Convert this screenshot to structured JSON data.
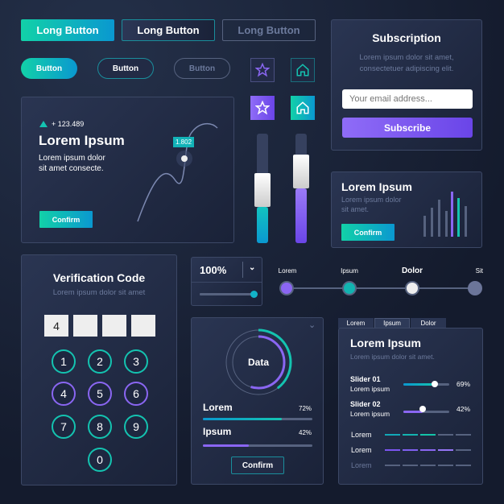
{
  "buttons": {
    "long": [
      "Long Button",
      "Long Button",
      "Long Button"
    ],
    "pill": [
      "Button",
      "Button",
      "Button"
    ]
  },
  "icons": {
    "star": "star-icon",
    "home": "home-icon"
  },
  "chart_card": {
    "delta": "+ 123.489",
    "title": "Lorem Ipsum",
    "text1": "Lorem ipsum dolor",
    "text2": "sit amet consecte.",
    "tooltip": "1.802",
    "confirm": "Confirm"
  },
  "vsliders": [
    {
      "value": 35,
      "color": "#12c3c0"
    },
    {
      "value": 53,
      "color": "#7c55f0"
    }
  ],
  "subscription": {
    "title": "Subscription",
    "text1": "Lorem ipsum dolor sit amet,",
    "text2": "consectetuer adipiscing elit.",
    "placeholder": "Your email address...",
    "button": "Subscribe"
  },
  "info_card": {
    "title": "Lorem Ipsum",
    "text1": "Lorem ipsum dolor",
    "text2": "sit amet.",
    "button": "Confirm"
  },
  "verification": {
    "title": "Verification Code",
    "subtitle": "Lorem ipsum dolor sit amet",
    "digits": [
      "4",
      "",
      "",
      ""
    ],
    "keys": [
      "1",
      "2",
      "3",
      "4",
      "5",
      "6",
      "7",
      "8",
      "9",
      "0"
    ]
  },
  "zoom": {
    "value": "100%",
    "slider": 100
  },
  "stepper": {
    "steps": [
      "Lorem",
      "Ipsum",
      "Dolor",
      "Sit"
    ],
    "active": 2
  },
  "data_card": {
    "center": "Data",
    "rows": [
      {
        "label": "Lorem",
        "value": "72%",
        "pct": 72
      },
      {
        "label": "Ipsum",
        "value": "42%",
        "pct": 42
      }
    ],
    "confirm": "Confirm"
  },
  "tabs_card": {
    "tabs": [
      "Lorem",
      "Ipsum",
      "Dolor"
    ],
    "active": 1,
    "title": "Lorem Ipsum",
    "subtitle": "Lorem ipsum dolor sit amet.",
    "sliders": [
      {
        "title": "Slider 01",
        "sub": "Lorem ipsum",
        "value": "69%",
        "pct": 69
      },
      {
        "title": "Slider 02",
        "sub": "Lorem ipsum",
        "value": "42%",
        "pct": 42
      }
    ],
    "levels": [
      {
        "label": "Lorem",
        "filled": 3
      },
      {
        "label": "Lorem",
        "filled": 4
      },
      {
        "label": "Lorem",
        "filled": 0
      }
    ]
  },
  "colors": {
    "teal": "#12d1a8",
    "blue": "#0a98d0",
    "purple": "#7c55f0",
    "bg": "#1a2238"
  }
}
